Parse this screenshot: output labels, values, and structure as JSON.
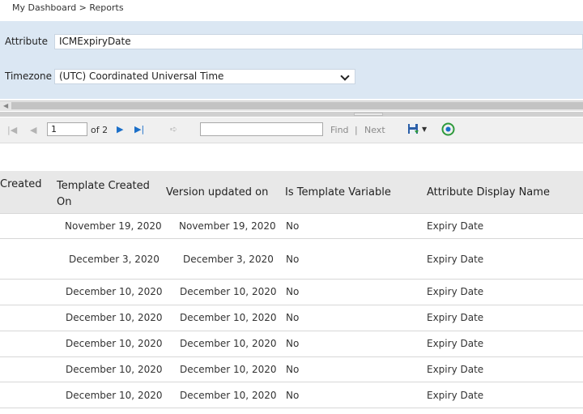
{
  "breadcrumb": "My Dashboard > Reports",
  "params": {
    "attribute_label": "Attribute",
    "attribute_value": "ICMExpiryDate",
    "timezone_label": "Timezone",
    "timezone_value": "(UTC) Coordinated Universal Time"
  },
  "toolbar": {
    "page_value": "1",
    "of_pages": "of 2",
    "find_label": "Find",
    "separator": "|",
    "next_label": "Next"
  },
  "table": {
    "headers": [
      "Created",
      "Template Created On",
      "Version updated on",
      "Is Template Variable",
      "Attribute Display Name"
    ],
    "rows": [
      [
        "",
        "November 19, 2020",
        "November 19, 2020",
        "No",
        "Expiry Date"
      ],
      [
        "",
        "December 3, 2020",
        "December 3, 2020",
        "No",
        "Expiry Date"
      ],
      [
        "",
        "December 10, 2020",
        "December 10, 2020",
        "No",
        "Expiry Date"
      ],
      [
        "",
        "December 10, 2020",
        "December 10, 2020",
        "No",
        "Expiry Date"
      ],
      [
        "",
        "December 10, 2020",
        "December 10, 2020",
        "No",
        "Expiry Date"
      ],
      [
        "",
        "December 10, 2020",
        "December 10, 2020",
        "No",
        "Expiry Date"
      ],
      [
        "",
        "December 10, 2020",
        "December 10, 2020",
        "No",
        "Expiry Date"
      ]
    ]
  },
  "colors": {
    "param_bg": "#dbe7f3",
    "accent_blue": "#1b6fc8",
    "refresh_green": "#2e9a3c"
  }
}
